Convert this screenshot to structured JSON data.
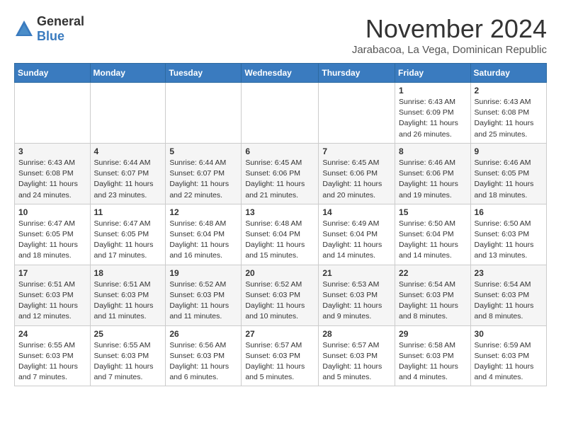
{
  "header": {
    "logo_general": "General",
    "logo_blue": "Blue",
    "month_title": "November 2024",
    "location": "Jarabacoa, La Vega, Dominican Republic"
  },
  "days_of_week": [
    "Sunday",
    "Monday",
    "Tuesday",
    "Wednesday",
    "Thursday",
    "Friday",
    "Saturday"
  ],
  "weeks": [
    [
      {
        "day": "",
        "info": ""
      },
      {
        "day": "",
        "info": ""
      },
      {
        "day": "",
        "info": ""
      },
      {
        "day": "",
        "info": ""
      },
      {
        "day": "",
        "info": ""
      },
      {
        "day": "1",
        "info": "Sunrise: 6:43 AM\nSunset: 6:09 PM\nDaylight: 11 hours and 26 minutes."
      },
      {
        "day": "2",
        "info": "Sunrise: 6:43 AM\nSunset: 6:08 PM\nDaylight: 11 hours and 25 minutes."
      }
    ],
    [
      {
        "day": "3",
        "info": "Sunrise: 6:43 AM\nSunset: 6:08 PM\nDaylight: 11 hours and 24 minutes."
      },
      {
        "day": "4",
        "info": "Sunrise: 6:44 AM\nSunset: 6:07 PM\nDaylight: 11 hours and 23 minutes."
      },
      {
        "day": "5",
        "info": "Sunrise: 6:44 AM\nSunset: 6:07 PM\nDaylight: 11 hours and 22 minutes."
      },
      {
        "day": "6",
        "info": "Sunrise: 6:45 AM\nSunset: 6:06 PM\nDaylight: 11 hours and 21 minutes."
      },
      {
        "day": "7",
        "info": "Sunrise: 6:45 AM\nSunset: 6:06 PM\nDaylight: 11 hours and 20 minutes."
      },
      {
        "day": "8",
        "info": "Sunrise: 6:46 AM\nSunset: 6:06 PM\nDaylight: 11 hours and 19 minutes."
      },
      {
        "day": "9",
        "info": "Sunrise: 6:46 AM\nSunset: 6:05 PM\nDaylight: 11 hours and 18 minutes."
      }
    ],
    [
      {
        "day": "10",
        "info": "Sunrise: 6:47 AM\nSunset: 6:05 PM\nDaylight: 11 hours and 18 minutes."
      },
      {
        "day": "11",
        "info": "Sunrise: 6:47 AM\nSunset: 6:05 PM\nDaylight: 11 hours and 17 minutes."
      },
      {
        "day": "12",
        "info": "Sunrise: 6:48 AM\nSunset: 6:04 PM\nDaylight: 11 hours and 16 minutes."
      },
      {
        "day": "13",
        "info": "Sunrise: 6:48 AM\nSunset: 6:04 PM\nDaylight: 11 hours and 15 minutes."
      },
      {
        "day": "14",
        "info": "Sunrise: 6:49 AM\nSunset: 6:04 PM\nDaylight: 11 hours and 14 minutes."
      },
      {
        "day": "15",
        "info": "Sunrise: 6:50 AM\nSunset: 6:04 PM\nDaylight: 11 hours and 14 minutes."
      },
      {
        "day": "16",
        "info": "Sunrise: 6:50 AM\nSunset: 6:03 PM\nDaylight: 11 hours and 13 minutes."
      }
    ],
    [
      {
        "day": "17",
        "info": "Sunrise: 6:51 AM\nSunset: 6:03 PM\nDaylight: 11 hours and 12 minutes."
      },
      {
        "day": "18",
        "info": "Sunrise: 6:51 AM\nSunset: 6:03 PM\nDaylight: 11 hours and 11 minutes."
      },
      {
        "day": "19",
        "info": "Sunrise: 6:52 AM\nSunset: 6:03 PM\nDaylight: 11 hours and 11 minutes."
      },
      {
        "day": "20",
        "info": "Sunrise: 6:52 AM\nSunset: 6:03 PM\nDaylight: 11 hours and 10 minutes."
      },
      {
        "day": "21",
        "info": "Sunrise: 6:53 AM\nSunset: 6:03 PM\nDaylight: 11 hours and 9 minutes."
      },
      {
        "day": "22",
        "info": "Sunrise: 6:54 AM\nSunset: 6:03 PM\nDaylight: 11 hours and 8 minutes."
      },
      {
        "day": "23",
        "info": "Sunrise: 6:54 AM\nSunset: 6:03 PM\nDaylight: 11 hours and 8 minutes."
      }
    ],
    [
      {
        "day": "24",
        "info": "Sunrise: 6:55 AM\nSunset: 6:03 PM\nDaylight: 11 hours and 7 minutes."
      },
      {
        "day": "25",
        "info": "Sunrise: 6:55 AM\nSunset: 6:03 PM\nDaylight: 11 hours and 7 minutes."
      },
      {
        "day": "26",
        "info": "Sunrise: 6:56 AM\nSunset: 6:03 PM\nDaylight: 11 hours and 6 minutes."
      },
      {
        "day": "27",
        "info": "Sunrise: 6:57 AM\nSunset: 6:03 PM\nDaylight: 11 hours and 5 minutes."
      },
      {
        "day": "28",
        "info": "Sunrise: 6:57 AM\nSunset: 6:03 PM\nDaylight: 11 hours and 5 minutes."
      },
      {
        "day": "29",
        "info": "Sunrise: 6:58 AM\nSunset: 6:03 PM\nDaylight: 11 hours and 4 minutes."
      },
      {
        "day": "30",
        "info": "Sunrise: 6:59 AM\nSunset: 6:03 PM\nDaylight: 11 hours and 4 minutes."
      }
    ]
  ]
}
